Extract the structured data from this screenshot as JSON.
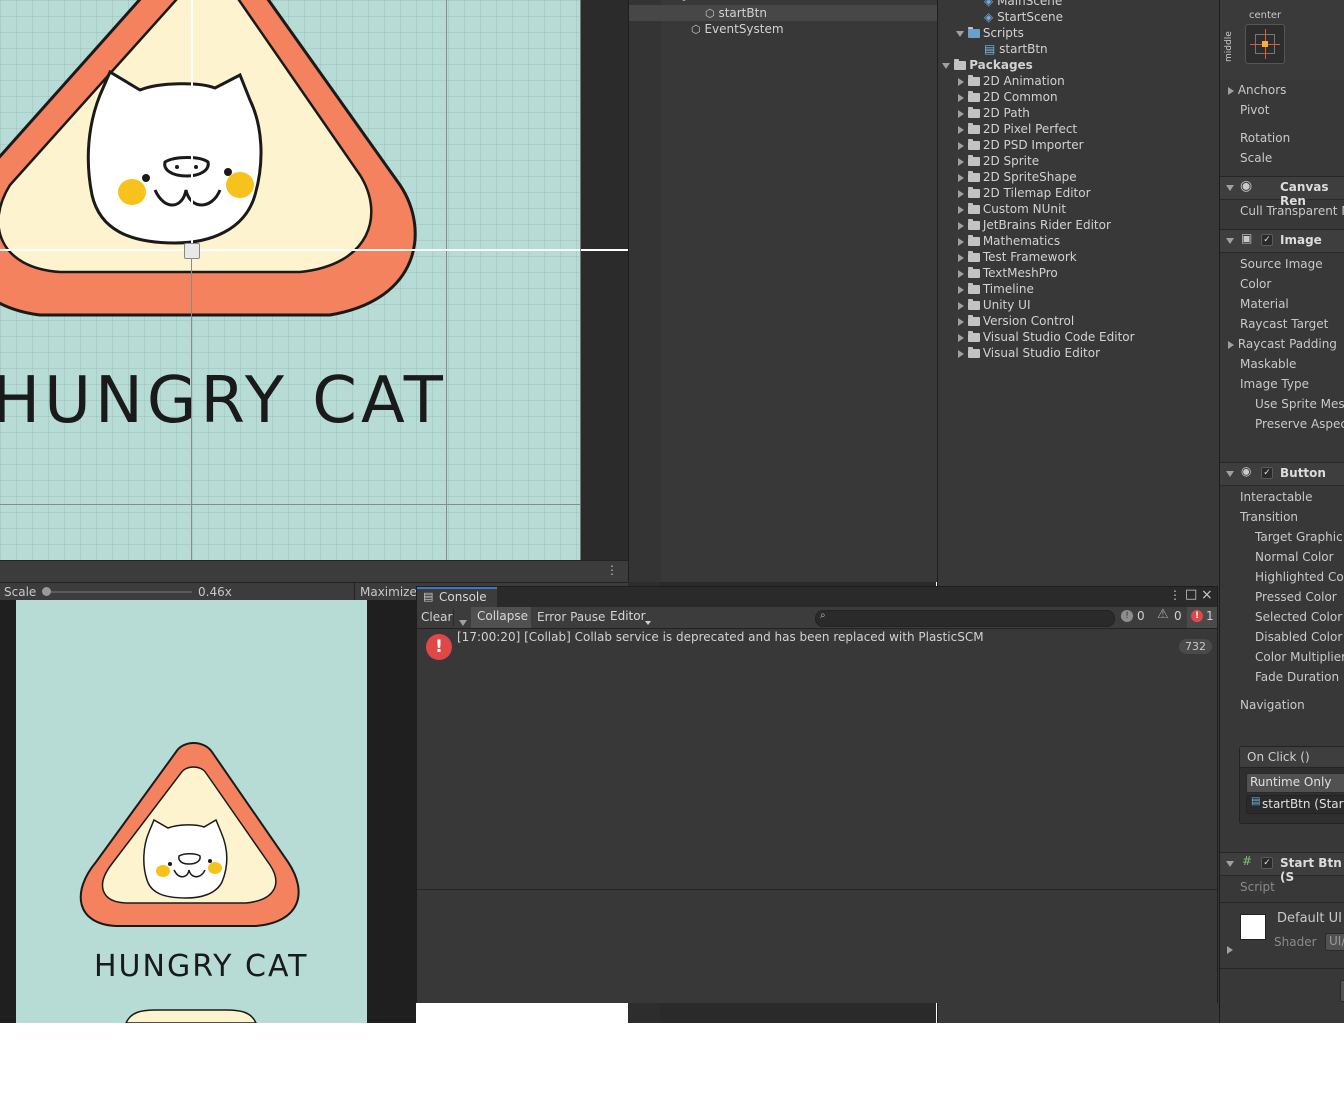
{
  "scene": {
    "title_text": "HUNGRY CAT",
    "scale_label": "Scale",
    "scale_value": 0.2,
    "scale_text": "0.46x",
    "maximize_label": "Maximize"
  },
  "game": {
    "title_text": "HUNGRY CAT"
  },
  "hierarchy": {
    "items": [
      {
        "label": "startBtn"
      },
      {
        "label": "EventSystem"
      }
    ]
  },
  "project": {
    "items": [
      {
        "label": "MainScene"
      },
      {
        "label": "StartScene"
      },
      {
        "label": "Scripts"
      },
      {
        "label": "startBtn"
      },
      {
        "label": "Packages"
      },
      {
        "label": "2D Animation"
      },
      {
        "label": "2D Common"
      },
      {
        "label": "2D Path"
      },
      {
        "label": "2D Pixel Perfect"
      },
      {
        "label": "2D PSD Importer"
      },
      {
        "label": "2D Sprite"
      },
      {
        "label": "2D SpriteShape"
      },
      {
        "label": "2D Tilemap Editor"
      },
      {
        "label": "Custom NUnit"
      },
      {
        "label": "JetBrains Rider Editor"
      },
      {
        "label": "Mathematics"
      },
      {
        "label": "Test Framework"
      },
      {
        "label": "TextMeshPro"
      },
      {
        "label": "Timeline"
      },
      {
        "label": "Unity UI"
      },
      {
        "label": "Version Control"
      },
      {
        "label": "Visual Studio Code Editor"
      },
      {
        "label": "Visual Studio Editor"
      }
    ]
  },
  "inspector": {
    "anchor_center": "center",
    "anchor_middle": "middle",
    "anchors": "Anchors",
    "pivot": "Pivot",
    "rotation": "Rotation",
    "scale": "Scale",
    "canvas_renderer": "Canvas Ren",
    "cull_transparent": "Cull Transparent M",
    "image": "Image",
    "source_image": "Source Image",
    "color": "Color",
    "material": "Material",
    "raycast_target": "Raycast Target",
    "raycast_padding": "Raycast Padding",
    "maskable": "Maskable",
    "image_type": "Image Type",
    "use_sprite_mesh": "Use Sprite Mesh",
    "preserve_aspect": "Preserve Aspect",
    "button": "Button",
    "interactable": "Interactable",
    "transition": "Transition",
    "target_graphic": "Target Graphic",
    "normal_color": "Normal Color",
    "highlighted_color": "Highlighted Colo",
    "pressed_color": "Pressed Color",
    "selected_color": "Selected Color",
    "disabled_color": "Disabled Color",
    "color_multiplier": "Color Multiplier",
    "fade_duration": "Fade Duration",
    "navigation": "Navigation",
    "on_click": "On Click ()",
    "runtime_only": "Runtime Only",
    "start_btn_ref": "startBtn (Start",
    "start_btn_component": "Start Btn (S",
    "script": "Script",
    "default_ui": "Default UI",
    "shader": "Shader",
    "shader_value": "UI/"
  },
  "console": {
    "tab_label": "Console",
    "clear": "Clear",
    "collapse": "Collapse",
    "error_pause": "Error Pause",
    "editor": "Editor",
    "info_count": "0",
    "warning_count": "0",
    "error_count": "1",
    "log_message": "[17:00:20] [Collab] Collab service is deprecated and has been replaced with PlasticSCM",
    "log_count": "732"
  },
  "colors": {
    "accent": "#3a79bb",
    "error": "#e04848",
    "scene_bg": "#b7dbd5",
    "triangle_outer": "#f4825f",
    "triangle_inner": "#fdf3cf",
    "cheek": "#f7c21c"
  }
}
